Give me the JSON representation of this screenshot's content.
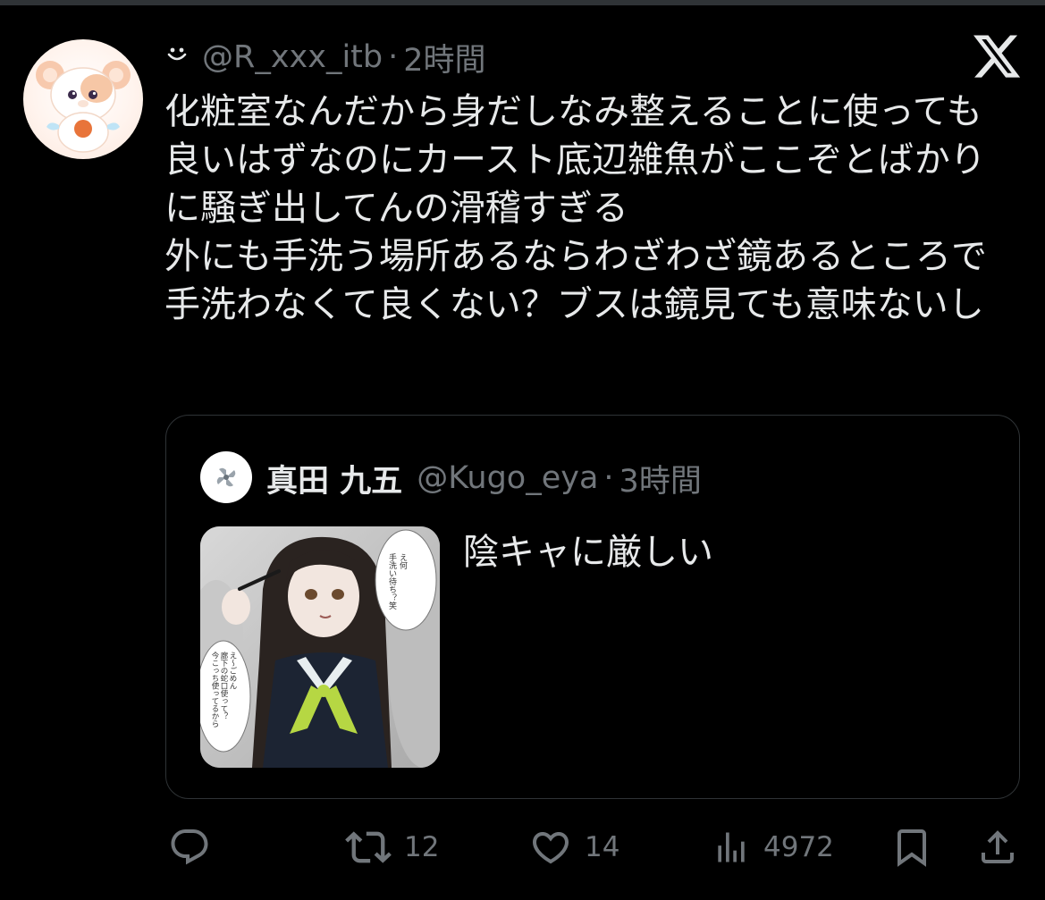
{
  "tweet": {
    "user_handle": "@R_xxx_itb",
    "time": "2時間",
    "name_icon": "smile-icon",
    "text": "化粧室なんだから身だしなみ整えることに使っても良いはずなのにカースト底辺雑魚がここぞとばかりに騒ぎ出してんの滑稽すぎる\n外にも手洗う場所あるならわざわざ鏡あるところで手洗わなくて良くない？ブスは鏡見ても意味ないし"
  },
  "quoted": {
    "name": "真田 九五",
    "handle": "@Kugo_eya",
    "time": "3時間",
    "text": "陰キャに厳しい",
    "image_bubbles": {
      "top_right": "え何\n手洗い待ち？笑",
      "left": "え～ごめん\n廊下の蛇口使って？\n今こっち使ってるから"
    }
  },
  "actions": {
    "reply_count": "",
    "retweet_count": "12",
    "like_count": "14",
    "views_count": "4972"
  },
  "icons": {
    "reply": "reply-icon",
    "retweet": "retweet-icon",
    "like": "heart-icon",
    "views": "views-icon",
    "bookmark": "bookmark-icon",
    "share": "share-icon",
    "logo": "x-logo-icon"
  },
  "colors": {
    "background": "#000000",
    "text": "#e7e9ea",
    "muted": "#71767b",
    "border": "#2f3336"
  }
}
